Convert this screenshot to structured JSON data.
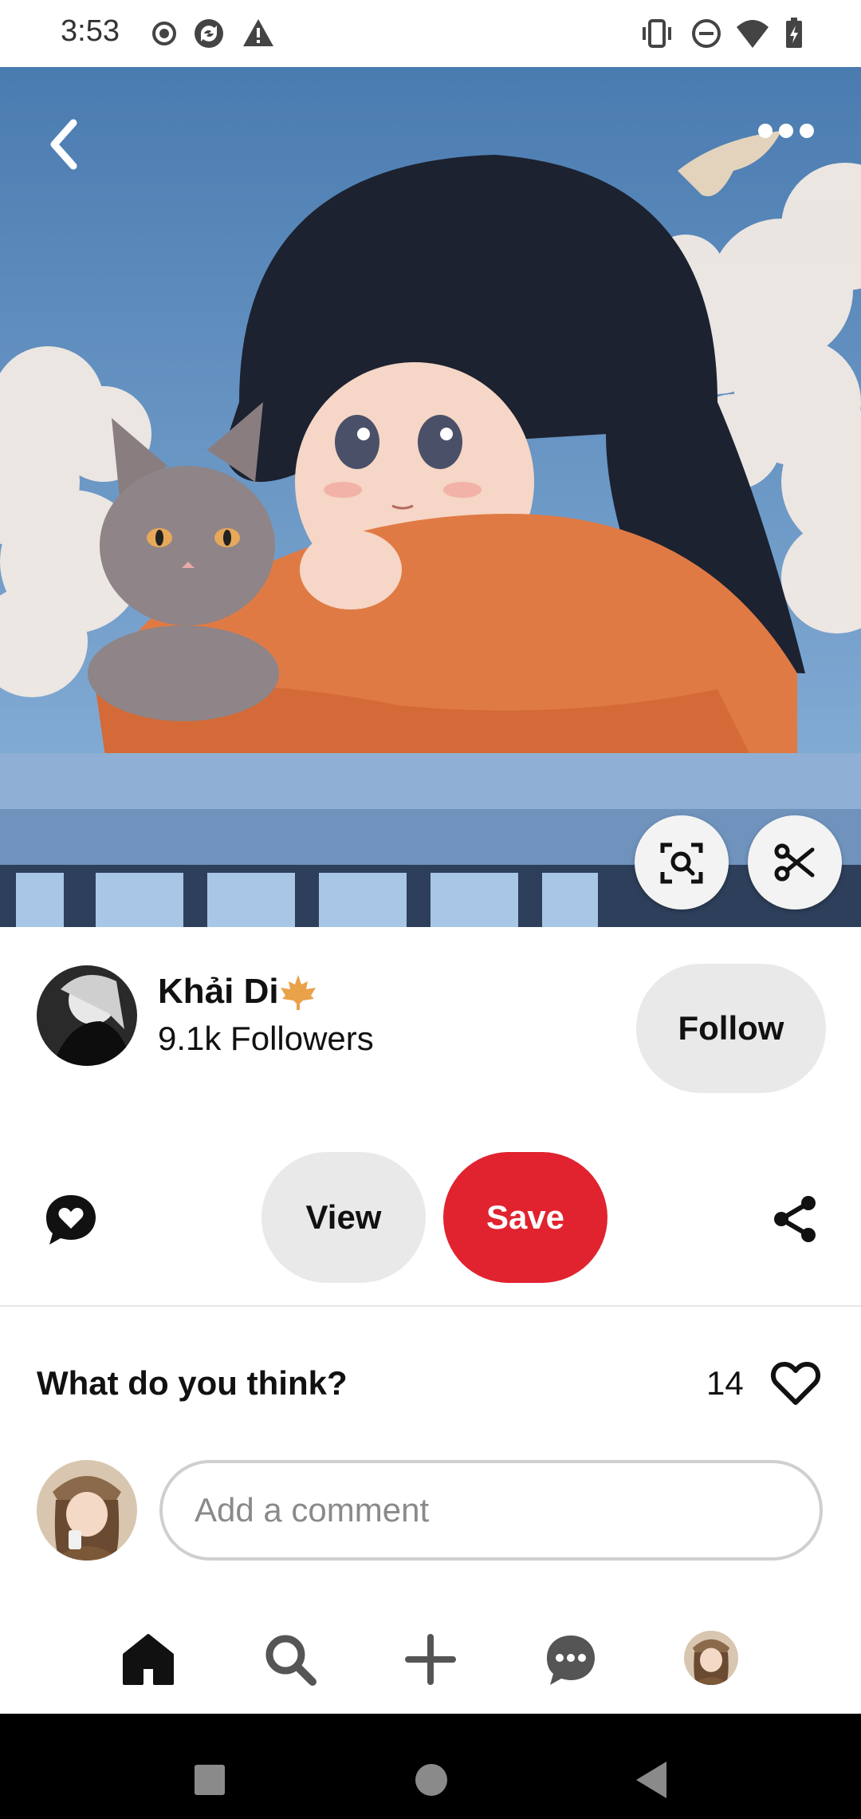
{
  "status_bar": {
    "time": "3:53",
    "left_icons": [
      "record-icon",
      "sync-icon",
      "warning-icon"
    ],
    "right_icons": [
      "vibrate-icon",
      "do-not-disturb-icon",
      "wifi-icon",
      "battery-icon"
    ]
  },
  "hero": {
    "back_icon": "chevron-left-icon",
    "more_icon": "more-dots-icon",
    "visual_search_icon": "lens-search-icon",
    "crop_icon": "scissors-icon"
  },
  "author": {
    "name": "Khải Di",
    "badge_icon": "maple-leaf-icon",
    "followers": "9.1k Followers",
    "follow_label": "Follow"
  },
  "actions": {
    "react_icon": "heart-bubble-icon",
    "view_label": "View",
    "save_label": "Save",
    "share_icon": "share-icon"
  },
  "comments": {
    "prompt": "What do you think?",
    "like_count": "14",
    "input_placeholder": "Add a comment"
  },
  "bottom_nav": {
    "items": [
      "home-icon",
      "search-icon",
      "plus-icon",
      "messages-icon",
      "profile-avatar"
    ]
  },
  "colors": {
    "save": "#e0232f",
    "pill": "#e9e9e9",
    "sky": "#5f8fc0",
    "sweater": "#e07a45"
  }
}
